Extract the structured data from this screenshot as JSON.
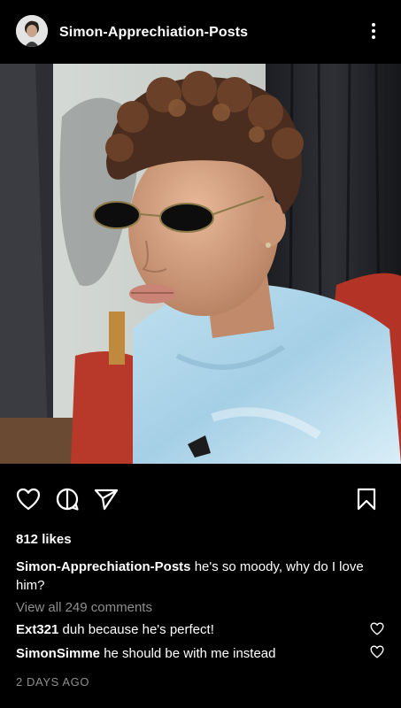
{
  "header": {
    "username": "Simon-Apprechiation-Posts"
  },
  "post": {
    "likes": "812 likes",
    "caption_user": "Simon-Apprechiation-Posts",
    "caption_text": "he's so moody, why do I love him?",
    "view_all": "View all 249 comments",
    "comments": [
      {
        "user": "Ext321",
        "text": "duh because he's perfect!"
      },
      {
        "user": "SimonSimme",
        "text": "he should be with me instead"
      }
    ],
    "timestamp": "2 DAYS AGO"
  },
  "icons": {
    "more": "more-options-icon",
    "like": "heart-icon",
    "comment": "comment-icon",
    "share": "send-icon",
    "save": "bookmark-icon"
  },
  "colors": {
    "background": "#000000",
    "text": "#ffffff",
    "muted": "#8e8e8e"
  }
}
